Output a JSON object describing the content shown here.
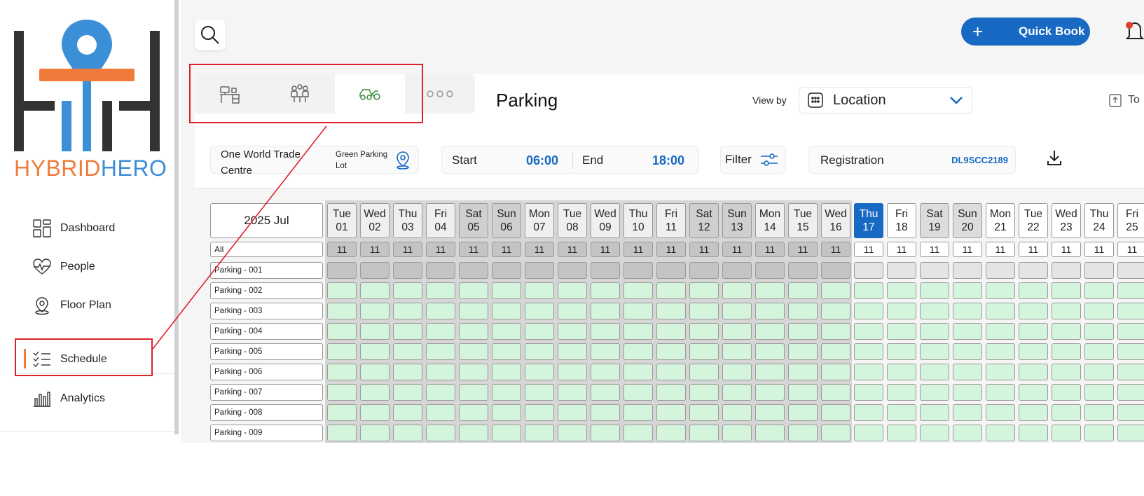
{
  "brand": {
    "name_part1": "HYBRID",
    "name_part2": "HERO",
    "color_orange": "#f07a3a",
    "color_blue": "#3b8fd6",
    "color_dark": "#333333"
  },
  "sidebar": {
    "items": [
      {
        "label": "Dashboard",
        "icon": "dashboard-grid-icon"
      },
      {
        "label": "People",
        "icon": "heart-pulse-icon"
      },
      {
        "label": "Floor Plan",
        "icon": "map-pin-icon"
      },
      {
        "label": "Schedule",
        "icon": "checklist-icon",
        "active": true
      },
      {
        "label": "Analytics",
        "icon": "bar-chart-icon"
      }
    ]
  },
  "header": {
    "quick_book_label": "Quick Book",
    "accent_color": "#1769c3"
  },
  "type_tabs": {
    "items": [
      {
        "name": "desk",
        "icon": "desk-icon"
      },
      {
        "name": "meeting",
        "icon": "people-group-icon"
      },
      {
        "name": "parking",
        "icon": "vehicle-icon",
        "active": true
      },
      {
        "name": "more",
        "icon": "more-dots-icon"
      }
    ]
  },
  "panel": {
    "title": "Parking",
    "view_by_label": "View by",
    "view_by_value": "Location",
    "tool_label": "To"
  },
  "filters": {
    "site": "One World Trade Centre",
    "lot": "Green Parking Lot",
    "start_label": "Start",
    "start_value": "06:00",
    "end_label": "End",
    "end_value": "18:00",
    "filter_label": "Filter",
    "registration_label": "Registration",
    "registration_value": "DL9SCC2189"
  },
  "calendar": {
    "month_label": "2025 Jul",
    "all_label": "All",
    "days": [
      {
        "dow": "Tue",
        "date": "01",
        "count": "11",
        "past": true,
        "weekend": false
      },
      {
        "dow": "Wed",
        "date": "02",
        "count": "11",
        "past": true,
        "weekend": false
      },
      {
        "dow": "Thu",
        "date": "03",
        "count": "11",
        "past": true,
        "weekend": false
      },
      {
        "dow": "Fri",
        "date": "04",
        "count": "11",
        "past": true,
        "weekend": false
      },
      {
        "dow": "Sat",
        "date": "05",
        "count": "11",
        "past": true,
        "weekend": true
      },
      {
        "dow": "Sun",
        "date": "06",
        "count": "11",
        "past": true,
        "weekend": true
      },
      {
        "dow": "Mon",
        "date": "07",
        "count": "11",
        "past": true,
        "weekend": false
      },
      {
        "dow": "Tue",
        "date": "08",
        "count": "11",
        "past": true,
        "weekend": false
      },
      {
        "dow": "Wed",
        "date": "09",
        "count": "11",
        "past": true,
        "weekend": false
      },
      {
        "dow": "Thu",
        "date": "10",
        "count": "11",
        "past": true,
        "weekend": false
      },
      {
        "dow": "Fri",
        "date": "11",
        "count": "11",
        "past": true,
        "weekend": false
      },
      {
        "dow": "Sat",
        "date": "12",
        "count": "11",
        "past": true,
        "weekend": true
      },
      {
        "dow": "Sun",
        "date": "13",
        "count": "11",
        "past": true,
        "weekend": true
      },
      {
        "dow": "Mon",
        "date": "14",
        "count": "11",
        "past": true,
        "weekend": false
      },
      {
        "dow": "Tue",
        "date": "15",
        "count": "11",
        "past": true,
        "weekend": false
      },
      {
        "dow": "Wed",
        "date": "16",
        "count": "11",
        "past": true,
        "weekend": false
      },
      {
        "dow": "Thu",
        "date": "17",
        "count": "11",
        "past": false,
        "weekend": false,
        "today": true
      },
      {
        "dow": "Fri",
        "date": "18",
        "count": "11",
        "past": false,
        "weekend": false
      },
      {
        "dow": "Sat",
        "date": "19",
        "count": "11",
        "past": false,
        "weekend": true
      },
      {
        "dow": "Sun",
        "date": "20",
        "count": "11",
        "past": false,
        "weekend": true
      },
      {
        "dow": "Mon",
        "date": "21",
        "count": "11",
        "past": false,
        "weekend": false
      },
      {
        "dow": "Tue",
        "date": "22",
        "count": "11",
        "past": false,
        "weekend": false
      },
      {
        "dow": "Wed",
        "date": "23",
        "count": "11",
        "past": false,
        "weekend": false
      },
      {
        "dow": "Thu",
        "date": "24",
        "count": "11",
        "past": false,
        "weekend": false
      },
      {
        "dow": "Fri",
        "date": "25",
        "count": "11",
        "past": false,
        "weekend": false
      }
    ],
    "rows": [
      {
        "label": "Parking - 001",
        "status": "blocked"
      },
      {
        "label": "Parking - 002",
        "status": "available"
      },
      {
        "label": "Parking - 003",
        "status": "available"
      },
      {
        "label": "Parking - 004",
        "status": "available"
      },
      {
        "label": "Parking - 005",
        "status": "available"
      },
      {
        "label": "Parking - 006",
        "status": "available"
      },
      {
        "label": "Parking - 007",
        "status": "available"
      },
      {
        "label": "Parking - 008",
        "status": "available"
      },
      {
        "label": "Parking - 009",
        "status": "available"
      }
    ],
    "colors": {
      "available": "#d4f5dc",
      "blocked": "#c4c4c4",
      "today": "#1769c3"
    }
  },
  "annotations": {
    "highlight_color": "#e0202a"
  }
}
